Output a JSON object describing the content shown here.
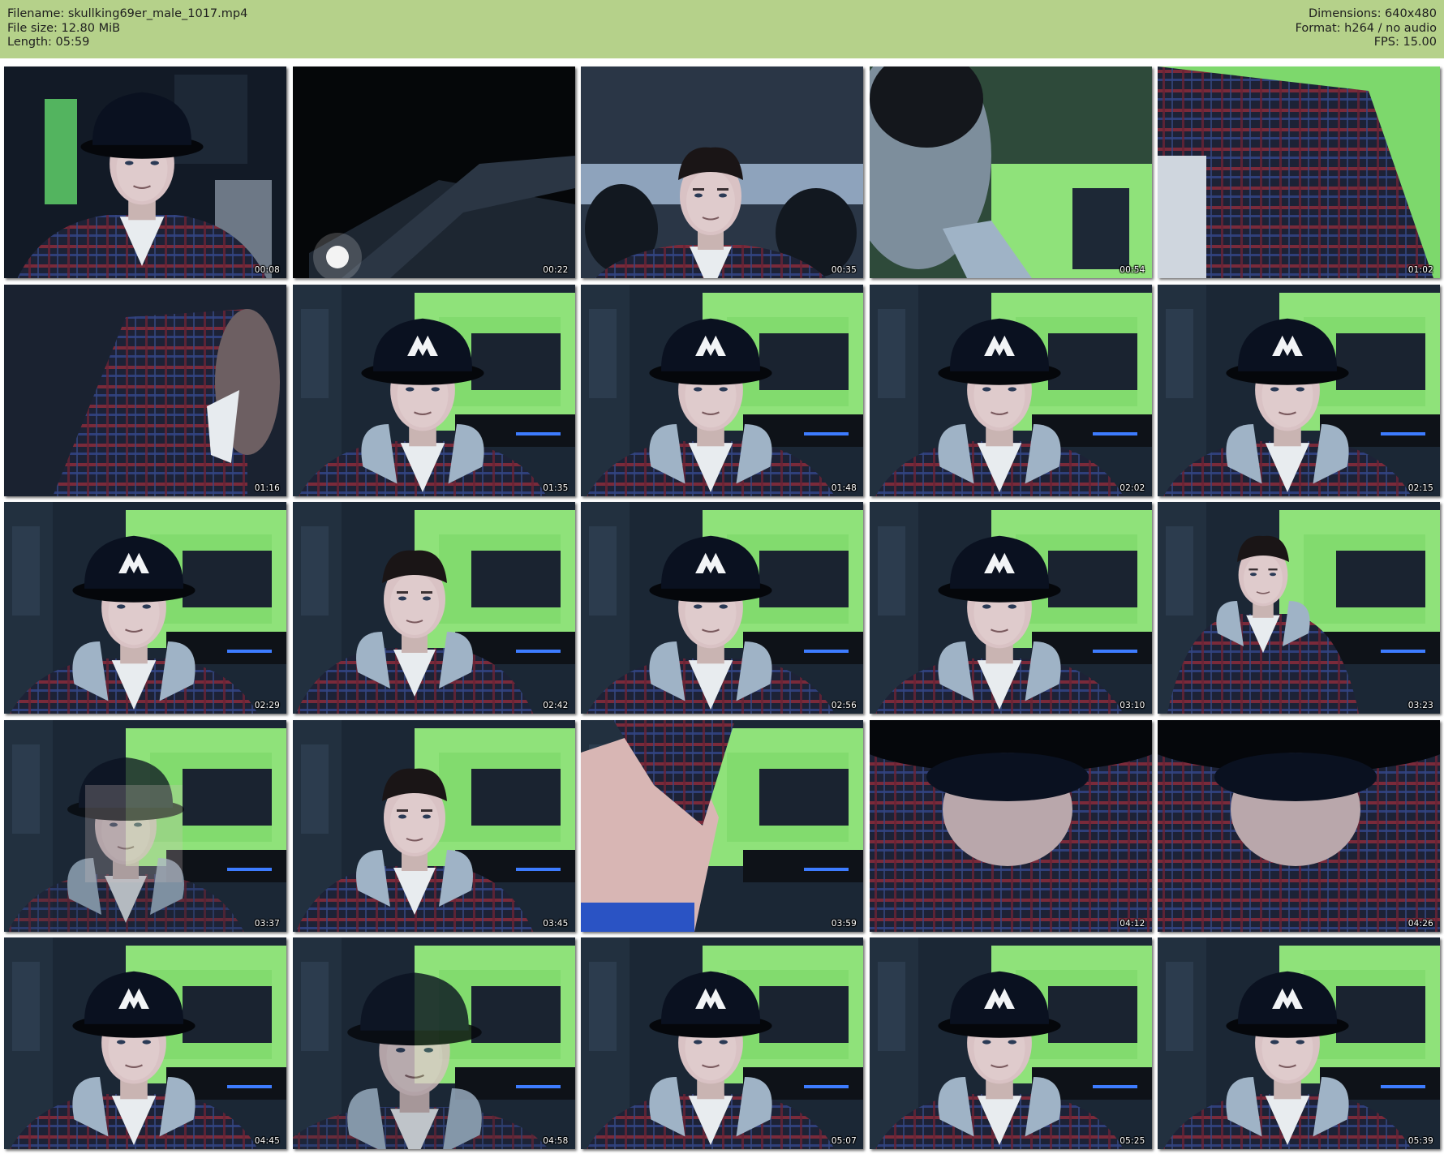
{
  "header": {
    "filename": "Filename: skullking69er_male_1017.mp4",
    "filesize": "File size: 12.80 MiB",
    "length": "Length: 05:59",
    "dimensions": "Dimensions: 640x480",
    "format": "Format: h264 / no audio",
    "fps": "FPS: 15.00",
    "background": "#b5d18a"
  },
  "thumbnails": [
    {
      "time": "00:08",
      "scene": "cap-face-dark"
    },
    {
      "time": "00:22",
      "scene": "dark-ceiling"
    },
    {
      "time": "00:35",
      "scene": "face-low"
    },
    {
      "time": "00:54",
      "scene": "side-neck"
    },
    {
      "time": "01:02",
      "scene": "shoulder-blur"
    },
    {
      "time": "01:16",
      "scene": "jacket-closeup"
    },
    {
      "time": "01:35",
      "scene": "cap-face-green"
    },
    {
      "time": "01:48",
      "scene": "cap-face-green"
    },
    {
      "time": "02:02",
      "scene": "cap-face-green"
    },
    {
      "time": "02:15",
      "scene": "cap-face-green"
    },
    {
      "time": "02:29",
      "scene": "cap-face-green"
    },
    {
      "time": "02:42",
      "scene": "face-green"
    },
    {
      "time": "02:56",
      "scene": "cap-face-green"
    },
    {
      "time": "03:10",
      "scene": "cap-face-green"
    },
    {
      "time": "03:23",
      "scene": "face-green-small"
    },
    {
      "time": "03:37",
      "scene": "motion-blur"
    },
    {
      "time": "03:45",
      "scene": "face-green"
    },
    {
      "time": "03:59",
      "scene": "torso-closeup"
    },
    {
      "time": "04:12",
      "scene": "cap-top-closeup"
    },
    {
      "time": "04:26",
      "scene": "cap-top-closeup"
    },
    {
      "time": "04:45",
      "scene": "cap-face-green"
    },
    {
      "time": "04:58",
      "scene": "cap-face-blur"
    },
    {
      "time": "05:07",
      "scene": "cap-face-green"
    },
    {
      "time": "05:25",
      "scene": "cap-face-green"
    },
    {
      "time": "05:39",
      "scene": "cap-face-green"
    }
  ]
}
